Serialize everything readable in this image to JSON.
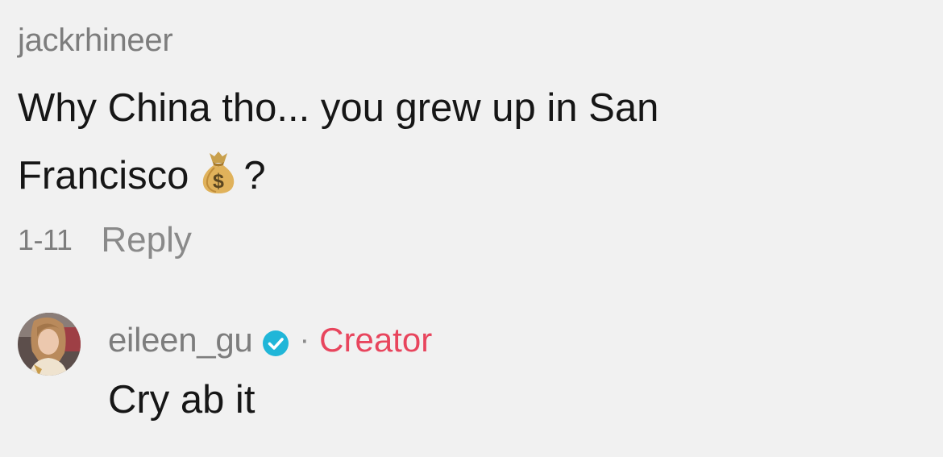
{
  "parent_comment": {
    "username": "jackrhineer",
    "text_line1": "Why China tho... you grew up in San",
    "text_line2": "Francisco",
    "emoji": "money-bag-icon",
    "text_suffix": "?",
    "date": "1-11",
    "reply_label": "Reply"
  },
  "reply_comment": {
    "username": "eileen_gu",
    "verified_icon": "verified-checkmark-icon",
    "separator": "·",
    "badge": "Creator",
    "text": "Cry ab it",
    "colors": {
      "badge": "#e8455d",
      "verified": "#20b6d8"
    }
  }
}
